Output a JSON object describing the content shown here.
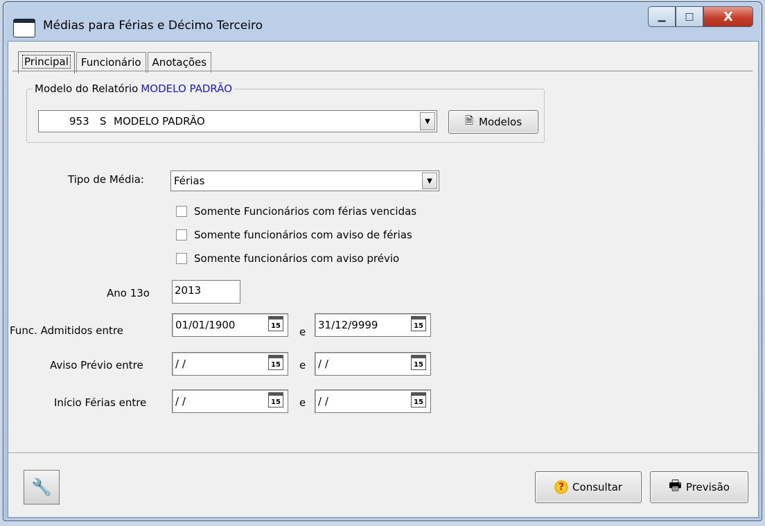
{
  "window": {
    "title": "Médias para Férias e Décimo Terceiro",
    "minimize": "▁",
    "maximize": "□",
    "close": "X"
  },
  "tabs": [
    {
      "label": "Principal",
      "active": true
    },
    {
      "label": "Funcionário",
      "active": false
    },
    {
      "label": "Anotações",
      "active": false
    }
  ],
  "modelo": {
    "group_label": "Modelo do Relatório",
    "group_value": "MODELO PADRÃO",
    "code": "953",
    "flag": "S",
    "name": "MODELO PADRÃO",
    "modelos_button": "Modelos"
  },
  "tipo_media": {
    "label": "Tipo de Média:",
    "value": "Férias"
  },
  "checkboxes": [
    {
      "label": "Somente Funcionários com férias vencidas",
      "checked": false
    },
    {
      "label": "Somente funcionários com aviso de férias",
      "checked": false
    },
    {
      "label": "Somente funcionários com aviso prévio",
      "checked": false
    }
  ],
  "ano13": {
    "label": "Ano 13o",
    "value": "2013"
  },
  "ranges": [
    {
      "label": "Func. Admitidos entre",
      "from": "01/01/1900",
      "sep": "e",
      "to": "31/12/9999"
    },
    {
      "label": "Aviso Prévio entre",
      "from": "/ /",
      "sep": "e",
      "to": "/ /"
    },
    {
      "label": "Início Férias entre",
      "from": "/ /",
      "sep": "e",
      "to": "/ /"
    }
  ],
  "calendar_icon_text": "15",
  "footer": {
    "consultar": "Consultar",
    "previsao": "Previsão"
  }
}
